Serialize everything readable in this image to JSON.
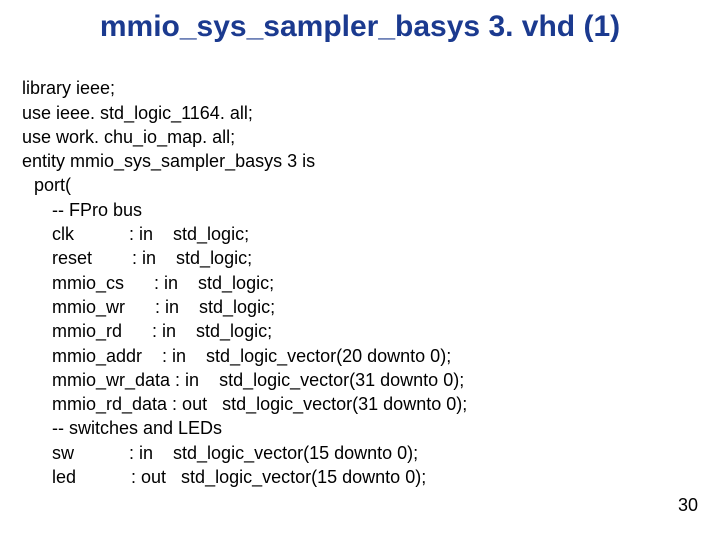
{
  "title": "mmio_sys_sampler_basys 3. vhd (1)",
  "code": {
    "l1": "library ieee;",
    "l2": "use ieee. std_logic_1164. all;",
    "l3": "use work. chu_io_map. all;",
    "l4": "entity mmio_sys_sampler_basys 3 is",
    "l5": "port(",
    "l6": "-- FPro bus",
    "l7": "clk           : in    std_logic;",
    "l8": "reset        : in    std_logic;",
    "l9": "mmio_cs      : in    std_logic;",
    "l10": "mmio_wr      : in    std_logic;",
    "l11": "mmio_rd      : in    std_logic;",
    "l12": "mmio_addr    : in    std_logic_vector(20 downto 0);",
    "l13": "mmio_wr_data : in    std_logic_vector(31 downto 0);",
    "l14": "mmio_rd_data : out   std_logic_vector(31 downto 0);",
    "l15": "-- switches and LEDs",
    "l16": "sw           : in    std_logic_vector(15 downto 0);",
    "l17": "led           : out   std_logic_vector(15 downto 0);"
  },
  "page_number": "30"
}
